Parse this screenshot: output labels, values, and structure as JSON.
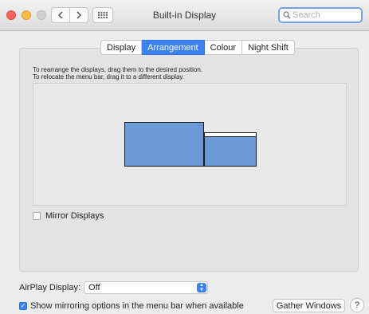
{
  "window": {
    "title": "Built-in Display"
  },
  "toolbar": {
    "back_icon": "chevron-left-icon",
    "forward_icon": "chevron-right-icon",
    "show_all_icon": "grid-icon",
    "search_placeholder": "Search"
  },
  "tabs": [
    {
      "label": "Display",
      "active": false
    },
    {
      "label": "Arrangement",
      "active": true
    },
    {
      "label": "Colour",
      "active": false
    },
    {
      "label": "Night Shift",
      "active": false
    }
  ],
  "arrangement": {
    "instruction_1": "To rearrange the displays, drag them to the desired position.",
    "instruction_2": "To relocate the menu bar, drag it to a different display.",
    "mirror_displays": {
      "label": "Mirror Displays",
      "checked": false
    }
  },
  "airplay": {
    "label": "AirPlay Display:",
    "value": "Off"
  },
  "show_mirroring": {
    "label": "Show mirroring options in the menu bar when available",
    "checked": true
  },
  "buttons": {
    "gather_windows": "Gather Windows",
    "help": "?"
  },
  "colors": {
    "accent": "#3b82f6",
    "display_fill": "#6b9bd6"
  }
}
